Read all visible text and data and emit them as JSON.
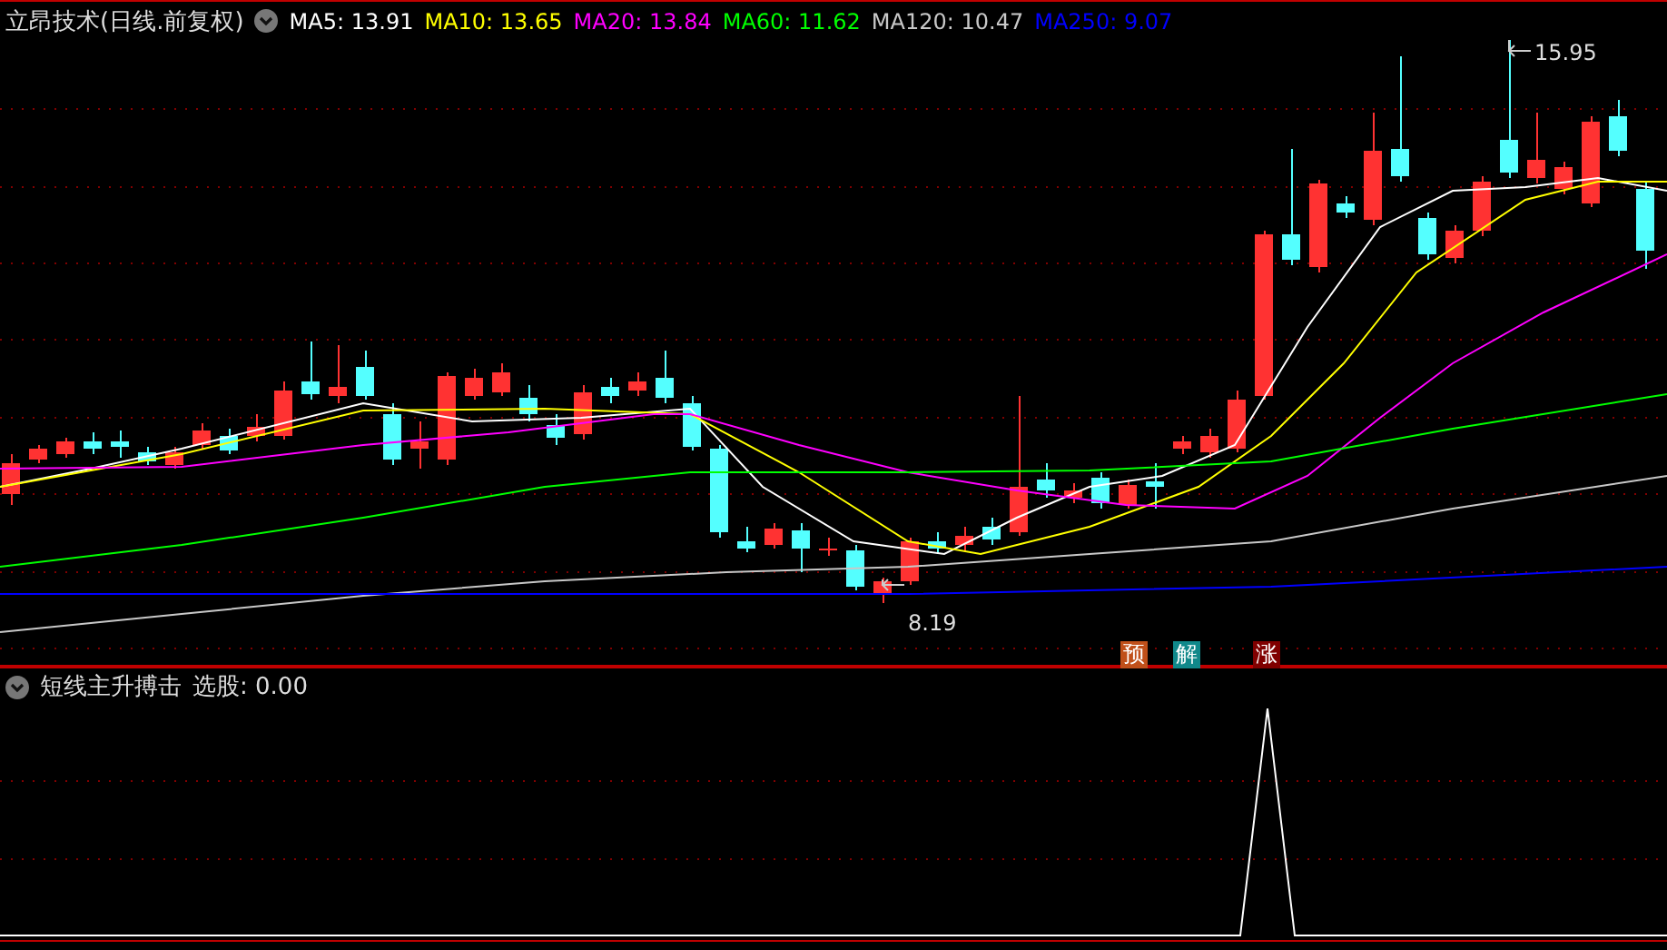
{
  "header": {
    "title": "立昂技术(日线.前复权)",
    "ma": [
      {
        "label": "MA5:",
        "value": "13.91",
        "color": "#ffffff"
      },
      {
        "label": "MA10:",
        "value": "13.65",
        "color": "#ffff00"
      },
      {
        "label": "MA20:",
        "value": "13.84",
        "color": "#ff00ff"
      },
      {
        "label": "MA60:",
        "value": "11.62",
        "color": "#00ff00"
      },
      {
        "label": "MA120:",
        "value": "10.47",
        "color": "#c8c8c8"
      },
      {
        "label": "MA250:",
        "value": "9.07",
        "color": "#0000ff"
      }
    ]
  },
  "price_chart": {
    "high_label": "15.95",
    "low_label": "8.19",
    "signals": [
      {
        "text": "预",
        "color": "#c0501a"
      },
      {
        "text": "解",
        "color": "#10888a"
      },
      {
        "text": "涨",
        "color": "#800000"
      }
    ]
  },
  "indicator": {
    "name": "短线主升搏击",
    "label": "选股:",
    "value": "0.00"
  }
}
